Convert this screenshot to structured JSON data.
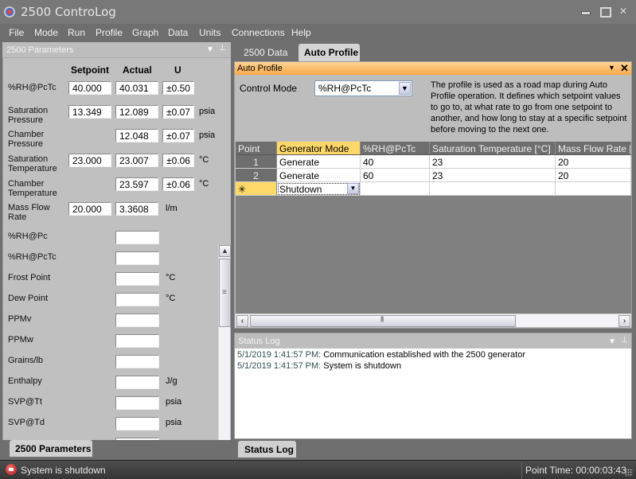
{
  "window": {
    "title": "2500 ControLog"
  },
  "menu": [
    "File",
    "Mode",
    "Run",
    "Profile",
    "Graph",
    "Data",
    "Units",
    "Connections",
    "Help"
  ],
  "left_panel": {
    "title": "2500 Parameters",
    "tab_label": "2500 Parameters",
    "columns": {
      "setpoint": "Setpoint",
      "actual": "Actual",
      "u": "U"
    },
    "params": [
      {
        "label": "%RH@PcTc",
        "setpoint": "40.000",
        "actual": "40.031",
        "u": "±0.50",
        "unit": ""
      },
      {
        "label": "Saturation Pressure",
        "setpoint": "13.349",
        "actual": "12.089",
        "u": "±0.07",
        "unit": "psia"
      },
      {
        "label": "Chamber Pressure",
        "setpoint": null,
        "actual": "12.048",
        "u": "±0.07",
        "unit": "psia"
      },
      {
        "label": "Saturation Temperature",
        "setpoint": "23.000",
        "actual": "23.007",
        "u": "±0.06",
        "unit": "°C"
      },
      {
        "label": "Chamber Temperature",
        "setpoint": null,
        "actual": "23.597",
        "u": "±0.06",
        "unit": "°C"
      },
      {
        "label": "Mass Flow Rate",
        "setpoint": "20.000",
        "actual": "3.3608",
        "u": null,
        "unit": "l/m"
      }
    ],
    "derived": [
      {
        "label": "%RH@Pc",
        "value": "",
        "unit": ""
      },
      {
        "label": "%RH@PcTc",
        "value": "",
        "unit": ""
      },
      {
        "label": "Frost Point",
        "value": "",
        "unit": "°C"
      },
      {
        "label": "Dew Point",
        "value": "",
        "unit": "°C"
      },
      {
        "label": "PPMv",
        "value": "",
        "unit": ""
      },
      {
        "label": "PPMw",
        "value": "",
        "unit": ""
      },
      {
        "label": "Grains/lb",
        "value": "",
        "unit": ""
      },
      {
        "label": "Enthalpy",
        "value": "",
        "unit": "J/g"
      },
      {
        "label": "SVP@Tt",
        "value": "",
        "unit": "psia"
      },
      {
        "label": "SVP@Td",
        "value": "",
        "unit": "psia"
      }
    ]
  },
  "tabs": {
    "inactive": "2500 Data",
    "active": "Auto Profile"
  },
  "auto_profile": {
    "title": "Auto Profile",
    "control_mode_label": "Control Mode",
    "control_mode_value": "%RH@PcTc",
    "description": "The profile is used as a road map during Auto Profile operation. It defines which setpoint values to go to, at what rate to go from one setpoint to another, and how long to stay at a specific setpoint before moving to the next one.",
    "grid": {
      "columns": [
        "Point",
        "Generator Mode",
        "%RH@PcTc",
        "Saturation Temperature [°C]",
        "Mass Flow Rate [l/m]"
      ],
      "rows": [
        [
          "1",
          "Generate",
          "40",
          "23",
          "20"
        ],
        [
          "2",
          "Generate",
          "60",
          "23",
          "20"
        ]
      ],
      "new_row": {
        "marker": "✳",
        "generator_mode": "Shutdown"
      }
    }
  },
  "status_log": {
    "title": "Status Log",
    "tab_label": "Status Log",
    "entries": [
      {
        "time": "5/1/2019 1:41:57 PM:",
        "message": "Communication established with the 2500 generator"
      },
      {
        "time": "5/1/2019 1:41:57 PM:",
        "message": "System is shutdown"
      }
    ]
  },
  "statusbar": {
    "status": "System is shutdown",
    "point_time": "Point Time: 00:00:03:43"
  },
  "colors": {
    "accent_orange": "#f7a84a",
    "selected_header": "#ffd86a",
    "stop_red": "#c02020"
  }
}
